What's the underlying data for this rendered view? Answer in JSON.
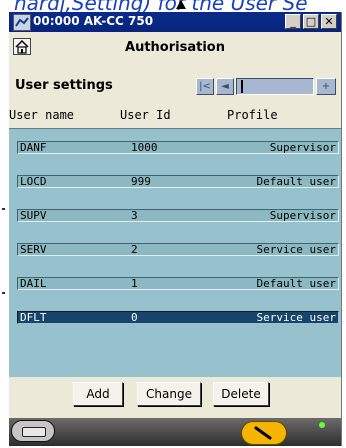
{
  "background_text": "hardj,Setting) for the User Se",
  "window": {
    "title": "00:000 AK-CC 750"
  },
  "window_buttons": {
    "minimize": "_",
    "maximize": "□",
    "close": "✕"
  },
  "header": {
    "title": "Authorisation"
  },
  "user_settings": {
    "label": "User settings",
    "nav": {
      "first": "|<",
      "prev": "◄",
      "next": "+"
    }
  },
  "columns": {
    "name": "User name",
    "id": "User Id",
    "profile": "Profile"
  },
  "users": [
    {
      "name": "DANF",
      "id": "1000",
      "profile": "Supervisor"
    },
    {
      "name": "LOCD",
      "id": "999",
      "profile": "Default user"
    },
    {
      "name": "SUPV",
      "id": "3",
      "profile": "Supervisor"
    },
    {
      "name": "SERV",
      "id": "2",
      "profile": "Service user"
    },
    {
      "name": "DAIL",
      "id": "1",
      "profile": "Default user"
    },
    {
      "name": "DFLT",
      "id": "0",
      "profile": "Service user"
    }
  ],
  "selected_user": "DFLT",
  "buttons": {
    "add": "Add",
    "change": "Change",
    "delete": "Delete"
  },
  "colors": {
    "titlebar": "#0b2a8a",
    "list_bg": "#97c1cc",
    "selected_row": "#17456a",
    "nav_button": "#a6b7cf"
  },
  "icons": {
    "app": "network-icon",
    "home": "home-icon",
    "status_left": "device-icon",
    "status_right": "wrench-icon",
    "status_led": "led-icon"
  }
}
